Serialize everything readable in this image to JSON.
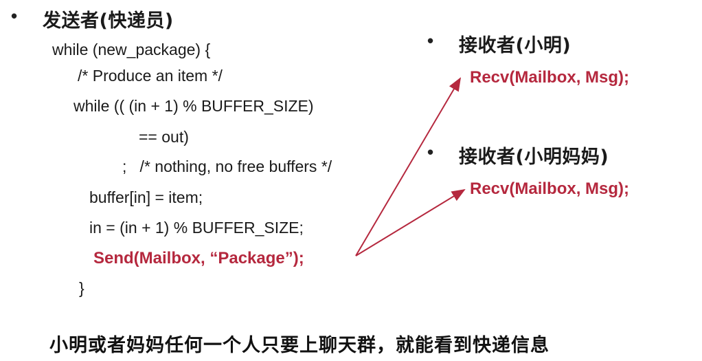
{
  "colors": {
    "accent": "#b5283e",
    "text": "#1a1a1a"
  },
  "bullet_glyph": "•",
  "sender": {
    "heading": "发送者(快递员)",
    "code_lines": [
      "while (new_package) {",
      "/* Produce an item */",
      "while (( (in + 1) % BUFFER_SIZE)",
      "== out)",
      ";   /* nothing, no free buffers */",
      "buffer[in] = item;",
      "in = (in + 1) % BUFFER_SIZE;",
      "Send(Mailbox, “Package”);",
      "}"
    ]
  },
  "receivers": [
    {
      "heading": "接收者(小明)",
      "call": "Recv(Mailbox, Msg);"
    },
    {
      "heading": "接收者(小明妈妈)",
      "call": "Recv(Mailbox, Msg);"
    }
  ],
  "footer": "小明或者妈妈任何一个人只要上聊天群，就能看到快递信息"
}
